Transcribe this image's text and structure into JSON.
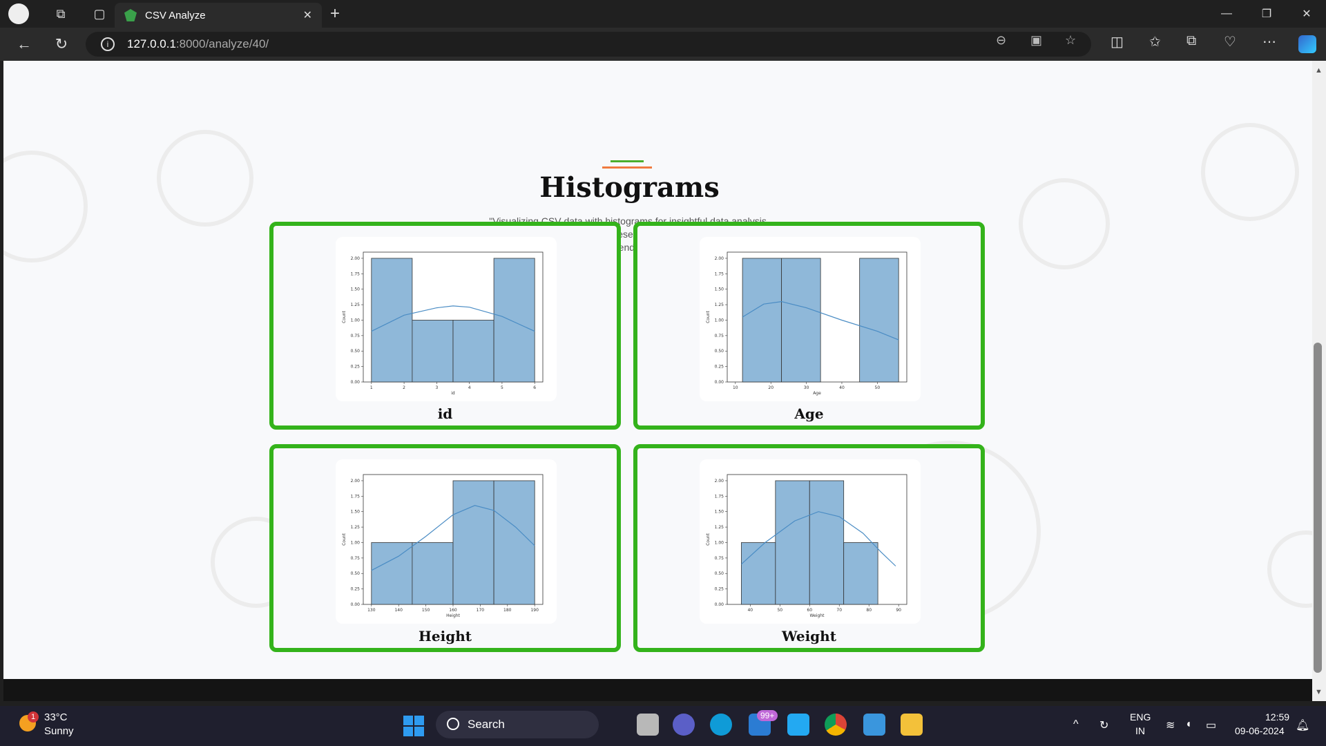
{
  "browser": {
    "tab_title": "CSV Analyze",
    "url_host": "127.0.0.1",
    "url_path": ":8000/analyze/40/"
  },
  "page": {
    "heading": "Histograms",
    "description": "\"Visualizing CSV data with histograms for insightful data analysis, providing clear, graphical representations of data distribution and trends.\""
  },
  "charts": [
    {
      "label": "id",
      "chart_data": {
        "type": "bar",
        "xlabel": "id",
        "ylabel": "Count",
        "xlim": [
          1,
          6
        ],
        "ylim": [
          0,
          2
        ],
        "xticks": [
          "1",
          "2",
          "3",
          "4",
          "5",
          "6"
        ],
        "yticks": [
          "0.00",
          "0.25",
          "0.50",
          "0.75",
          "1.00",
          "1.25",
          "1.50",
          "1.75",
          "2.00"
        ],
        "bins": [
          [
            1,
            2.25
          ],
          [
            2.25,
            3.5
          ],
          [
            3.5,
            4.75
          ],
          [
            4.75,
            6
          ]
        ],
        "values": [
          2,
          1,
          1,
          2
        ],
        "kde": [
          [
            1,
            0.82
          ],
          [
            2,
            1.08
          ],
          [
            3,
            1.2
          ],
          [
            3.5,
            1.23
          ],
          [
            4,
            1.21
          ],
          [
            5,
            1.06
          ],
          [
            6,
            0.82
          ]
        ]
      }
    },
    {
      "label": "Age",
      "chart_data": {
        "type": "bar",
        "xlabel": "Age",
        "ylabel": "Count",
        "xlim": [
          10,
          55
        ],
        "ylim": [
          0,
          2
        ],
        "xticks": [
          "10",
          "20",
          "30",
          "40",
          "50"
        ],
        "yticks": [
          "0.00",
          "0.25",
          "0.50",
          "0.75",
          "1.00",
          "1.25",
          "1.50",
          "1.75",
          "2.00"
        ],
        "bins": [
          [
            12,
            23
          ],
          [
            23,
            34
          ],
          [
            34,
            45
          ],
          [
            45,
            56
          ]
        ],
        "values": [
          2,
          2,
          0,
          2
        ],
        "kde": [
          [
            12,
            1.05
          ],
          [
            18,
            1.26
          ],
          [
            23,
            1.3
          ],
          [
            30,
            1.2
          ],
          [
            40,
            1.0
          ],
          [
            50,
            0.82
          ],
          [
            56,
            0.68
          ]
        ]
      }
    },
    {
      "label": "Height",
      "chart_data": {
        "type": "bar",
        "xlabel": "Height",
        "ylabel": "Count",
        "xlim": [
          130,
          190
        ],
        "ylim": [
          0,
          2
        ],
        "xticks": [
          "130",
          "140",
          "150",
          "160",
          "170",
          "180",
          "190"
        ],
        "yticks": [
          "0.00",
          "0.25",
          "0.50",
          "0.75",
          "1.00",
          "1.25",
          "1.50",
          "1.75",
          "2.00"
        ],
        "bins": [
          [
            130,
            145
          ],
          [
            145,
            160
          ],
          [
            160,
            175
          ],
          [
            175,
            190
          ]
        ],
        "values": [
          1,
          1,
          2,
          2
        ],
        "kde": [
          [
            130,
            0.55
          ],
          [
            140,
            0.78
          ],
          [
            150,
            1.1
          ],
          [
            160,
            1.45
          ],
          [
            168,
            1.6
          ],
          [
            175,
            1.52
          ],
          [
            183,
            1.25
          ],
          [
            190,
            0.95
          ]
        ]
      }
    },
    {
      "label": "Weight",
      "chart_data": {
        "type": "bar",
        "xlabel": "Weight",
        "ylabel": "Count",
        "xlim": [
          35,
          90
        ],
        "ylim": [
          0,
          2
        ],
        "xticks": [
          "40",
          "50",
          "60",
          "70",
          "80",
          "90"
        ],
        "yticks": [
          "0.00",
          "0.25",
          "0.50",
          "0.75",
          "1.00",
          "1.25",
          "1.50",
          "1.75",
          "2.00"
        ],
        "bins": [
          [
            37,
            48.5
          ],
          [
            48.5,
            60
          ],
          [
            60,
            71.5
          ],
          [
            71.5,
            83
          ]
        ],
        "values": [
          1,
          2,
          2,
          1
        ],
        "kde": [
          [
            37,
            0.65
          ],
          [
            45,
            1.0
          ],
          [
            55,
            1.35
          ],
          [
            63,
            1.5
          ],
          [
            70,
            1.42
          ],
          [
            78,
            1.15
          ],
          [
            84,
            0.85
          ],
          [
            89,
            0.62
          ]
        ]
      }
    }
  ],
  "taskbar": {
    "temp": "33°C",
    "weather": "Sunny",
    "weather_badge": "1",
    "search": "Search",
    "badge": "99+",
    "lang1": "ENG",
    "lang2": "IN",
    "time": "12:59",
    "date": "09-06-2024"
  },
  "colors": {
    "card_border": "#34b31b",
    "bar_fill": "#8fb8d9",
    "kde_line": "#4a8cc4"
  }
}
